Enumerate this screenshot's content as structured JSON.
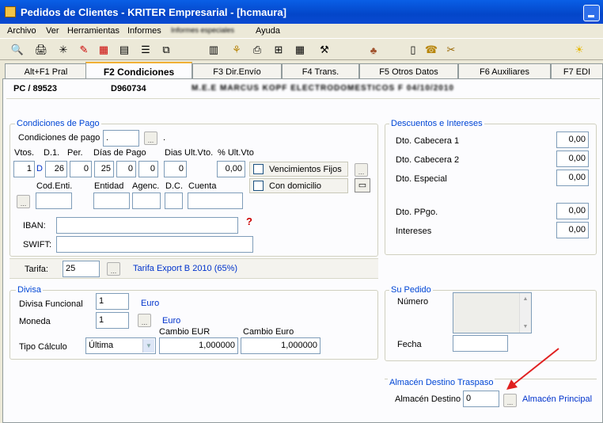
{
  "window": {
    "title": "Pedidos de Clientes - KRITER Empresarial - [hcmaura]"
  },
  "menu": [
    "Archivo",
    "Ver",
    "Herramientas",
    "Informes",
    "Informes especiales",
    "Ayuda"
  ],
  "toolbar_icons": [
    "preview-icon",
    "print-icon",
    "filter-icon",
    "tools-icon",
    "calendar-icon",
    "calc-icon",
    "list-icon",
    "tree-icon",
    "chart-icon",
    "network-icon",
    "printer-icon",
    "hierarchy-icon",
    "grid-icon",
    "wand-icon",
    "palette-icon",
    "document-icon",
    "phone-icon",
    "clip-icon",
    "bulb-icon"
  ],
  "tabs": [
    "Alt+F1 Pral",
    "F2 Condiciones",
    "F3 Dir.Envío",
    "F4 Trans.",
    "F5 Otros Datos",
    "F6 Auxiliares",
    "F7 EDI"
  ],
  "header": {
    "doc": "PC / 89523",
    "code": "D960734",
    "client": "M.E.E MARCUS KOPF ELECTRODOMESTICOS F 04/10/2010"
  },
  "condiciones": {
    "title": "Condiciones de Pago",
    "condiciones_label": "Condiciones de pago",
    "condiciones_value": ".",
    "condiciones_suffix": ".",
    "vtos_label": "Vtos.",
    "d1_label": "D.1.",
    "per_label": "Per.",
    "dias_label": "Días de Pago",
    "dias_ult_label": "Dias Ult.Vto.",
    "pct_ult_label": "% Ult.Vto",
    "vtos": "1",
    "d_flag": "D",
    "d1": "26",
    "per": "0",
    "dias": [
      "25",
      "0",
      "0"
    ],
    "dias_ult": "0",
    "pct_ult": "0,00",
    "venc_fijos": "Vencimientos Fijos",
    "con_domicilio": "Con domicilio",
    "cod_enti_label": "Cod.Enti.",
    "entidad_label": "Entidad",
    "agenc_label": "Agenc.",
    "dc_label": "D.C.",
    "cuenta_label": "Cuenta",
    "iban_label": "IBAN:",
    "swift_label": "SWIFT:",
    "tarifa_label": "Tarifa:",
    "tarifa_value": "25",
    "tarifa_desc": "Tarifa Export B 2010 (65%)"
  },
  "descuentos": {
    "title": "Descuentos e Intereses",
    "rows": [
      {
        "label": "Dto. Cabecera 1",
        "value": "0,00"
      },
      {
        "label": "Dto. Cabecera 2",
        "value": "0,00"
      },
      {
        "label": "Dto. Especial",
        "value": "0,00"
      },
      {
        "label": "Dto. PPgo.",
        "value": "0,00"
      },
      {
        "label": "Intereses",
        "value": "0,00"
      }
    ]
  },
  "divisa": {
    "title": "Divisa",
    "funcional_label": "Divisa Funcional",
    "funcional_value": "1",
    "funcional_desc": "Euro",
    "moneda_label": "Moneda",
    "moneda_value": "1",
    "moneda_desc": "Euro",
    "cambio_eur_label": "Cambio EUR",
    "cambio_euro_label": "Cambio Euro",
    "tipo_label": "Tipo Cálculo",
    "tipo_value": "Última",
    "cambio_eur": "1,000000",
    "cambio_euro": "1,000000"
  },
  "pedido": {
    "title": "Su Pedido",
    "numero_label": "Número",
    "fecha_label": "Fecha"
  },
  "almacen": {
    "title": "Almacén Destino Traspaso",
    "label": "Almacén Destino",
    "value": "0",
    "desc": "Almacén Principal"
  }
}
